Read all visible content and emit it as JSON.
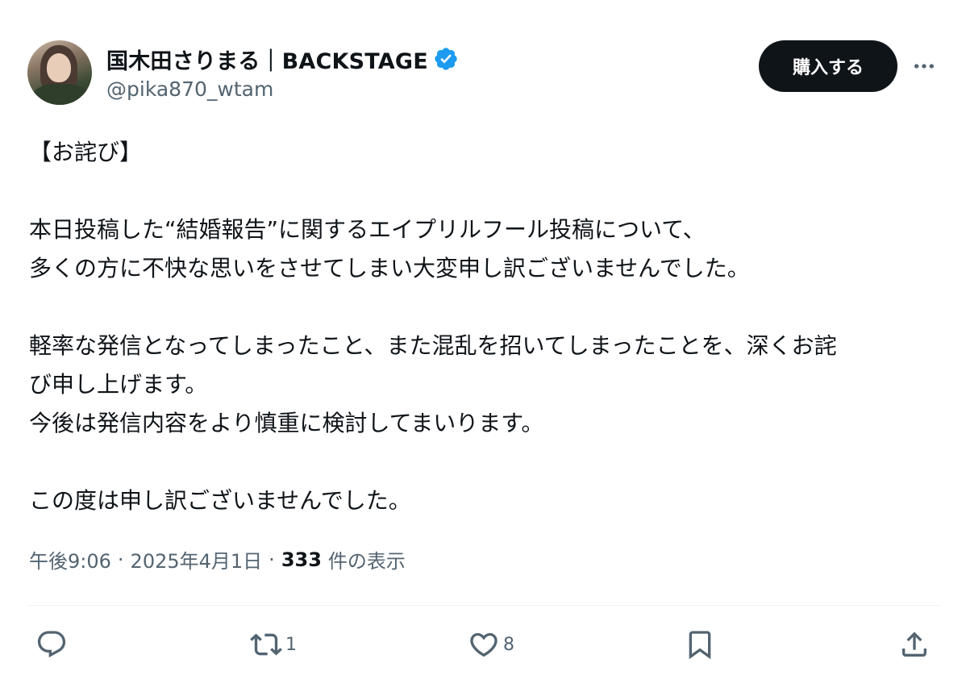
{
  "user": {
    "display_name": "国木田さりまる｜BACKSTAGE",
    "handle": "@pika870_wtam",
    "verified_icon": "verified-badge-icon",
    "avatar": "profile-photo"
  },
  "header": {
    "buy_label": "購入する",
    "more_icon": "more-icon"
  },
  "tweet": {
    "lines": {
      "l1": "【お詫び】",
      "l2": "本日投稿した“結婚報告”に関するエイプリルフール投稿について、",
      "l3": "多くの方に不快な思いをさせてしまい大変申し訳ございませんでした。",
      "l4": "軽率な発信となってしまったこと、また混乱を招いてしまったことを、深くお詫",
      "l5": "び申し上げます。",
      "l6": "今後は発信内容をより慎重に検討してまいります。",
      "l7": "この度は申し訳ございませんでした。"
    }
  },
  "meta": {
    "time": "午後9:06",
    "separator": "·",
    "date": "2025年4月1日",
    "views_count": "333",
    "views_label": "件の表示"
  },
  "actions": {
    "reply": {
      "icon": "reply-icon",
      "count": ""
    },
    "retweet": {
      "icon": "retweet-icon",
      "count": "1"
    },
    "like": {
      "icon": "heart-icon",
      "count": "8"
    },
    "bookmark": {
      "icon": "bookmark-icon",
      "count": ""
    },
    "share": {
      "icon": "share-icon",
      "count": ""
    }
  },
  "colors": {
    "text_primary": "#0f1419",
    "text_secondary": "#536471",
    "verified_blue": "#1d9bf0",
    "button_bg": "#0f1419",
    "divider": "#eff3f4"
  }
}
